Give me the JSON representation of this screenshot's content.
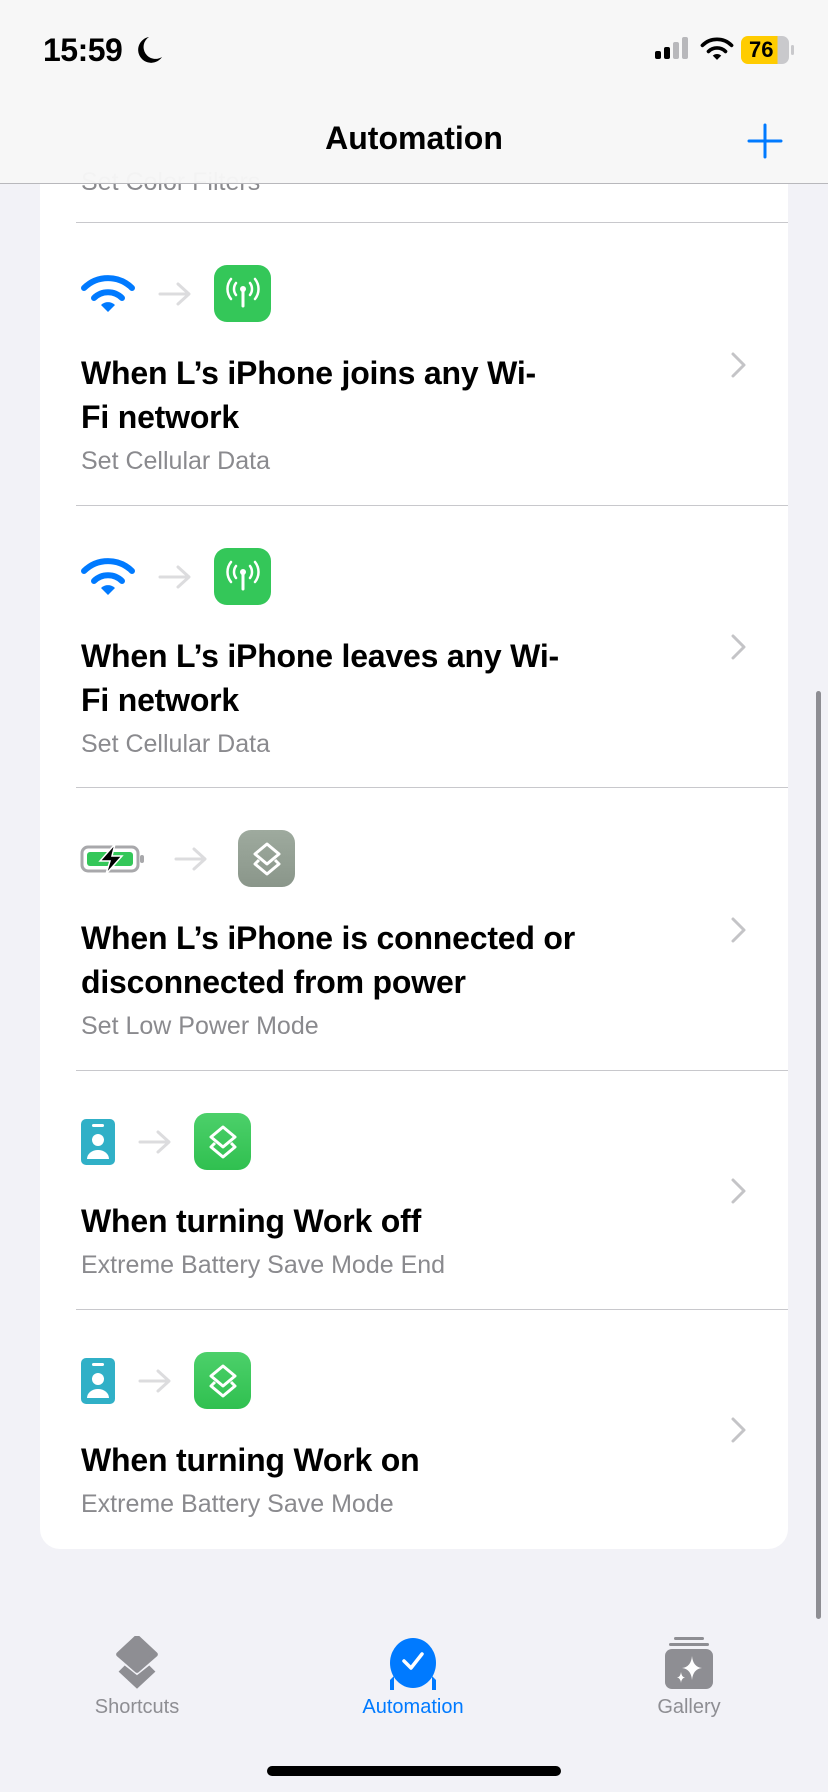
{
  "status_bar": {
    "time": "15:59",
    "battery": "76",
    "focus_icon": "moon-icon"
  },
  "nav": {
    "title": "Automation",
    "add_icon": "plus-icon"
  },
  "colors": {
    "accent": "#007aff",
    "green": "#34c759",
    "battery": "#ffcc00"
  },
  "partial_row": {
    "subtitle": "Set Color Filters"
  },
  "rows": [
    {
      "trigger_icon": "wifi-icon",
      "action_icon": "cellular-icon",
      "title_lines": [
        "When L’s iPhone joins any Wi-",
        "Fi network"
      ],
      "subtitle": "Set Cellular Data"
    },
    {
      "trigger_icon": "wifi-icon",
      "action_icon": "cellular-icon",
      "title_lines": [
        "When L’s iPhone leaves any Wi-",
        "Fi network"
      ],
      "subtitle": "Set Cellular Data"
    },
    {
      "trigger_icon": "battery-charging-icon",
      "action_icon": "shortcuts-icon",
      "title_lines": [
        "When L’s iPhone is connected or",
        "disconnected from power"
      ],
      "subtitle": "Set Low Power Mode"
    },
    {
      "trigger_icon": "work-focus-icon",
      "action_icon": "shortcuts-icon",
      "title_lines": [
        "When turning Work off"
      ],
      "subtitle": "Extreme Battery Save Mode End"
    },
    {
      "trigger_icon": "work-focus-icon",
      "action_icon": "shortcuts-icon",
      "title_lines": [
        "When turning Work on"
      ],
      "subtitle": "Extreme Battery Save Mode"
    }
  ],
  "tabs": [
    {
      "label": "Shortcuts"
    },
    {
      "label": "Automation",
      "active": true
    },
    {
      "label": "Gallery"
    }
  ]
}
